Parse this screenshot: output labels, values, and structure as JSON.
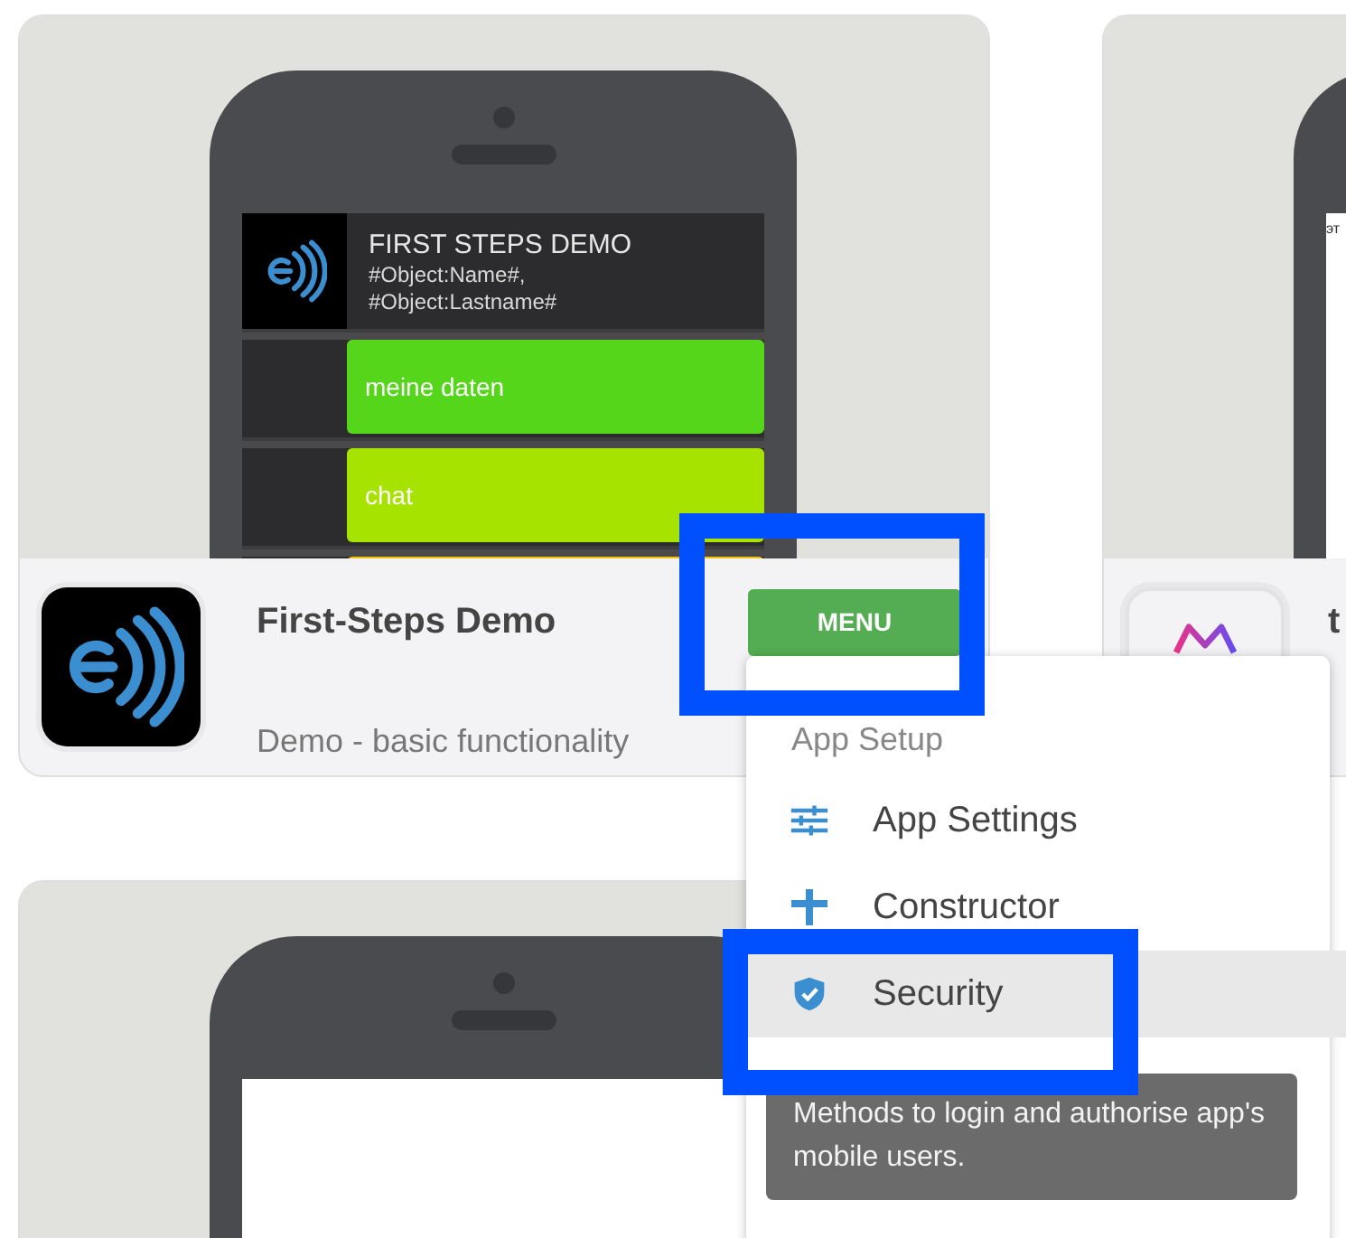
{
  "cards": [
    {
      "kind": "demo",
      "preview": {
        "header_title": "FIRST STEPS DEMO",
        "header_subtitle": "#Object:Name#, #Object:Lastname#",
        "tiles": [
          {
            "label": "meine daten",
            "color": "#55d61b"
          },
          {
            "label": "chat",
            "color": "#a6e300"
          },
          {
            "color": "#f5c400"
          }
        ]
      },
      "app_name": "First-Steps Demo",
      "description": "Demo - basic functionality",
      "menu_button": "MENU",
      "menu_button_highlighted": true
    },
    {
      "kind": "other",
      "preview": {
        "screen_text": "эт"
      },
      "app_name": "t"
    },
    {
      "kind": "preview-only"
    }
  ],
  "menu": {
    "header": "App Setup",
    "items": [
      {
        "label": "App Settings",
        "kind": "settings",
        "selected": false,
        "highlighted": false
      },
      {
        "label": "Constructor",
        "kind": "constructor",
        "selected": false,
        "highlighted": false
      },
      {
        "label": "Security",
        "kind": "security",
        "selected": true,
        "highlighted": true
      }
    ],
    "tooltip": "Methods to login and authorise app's mobile users."
  }
}
